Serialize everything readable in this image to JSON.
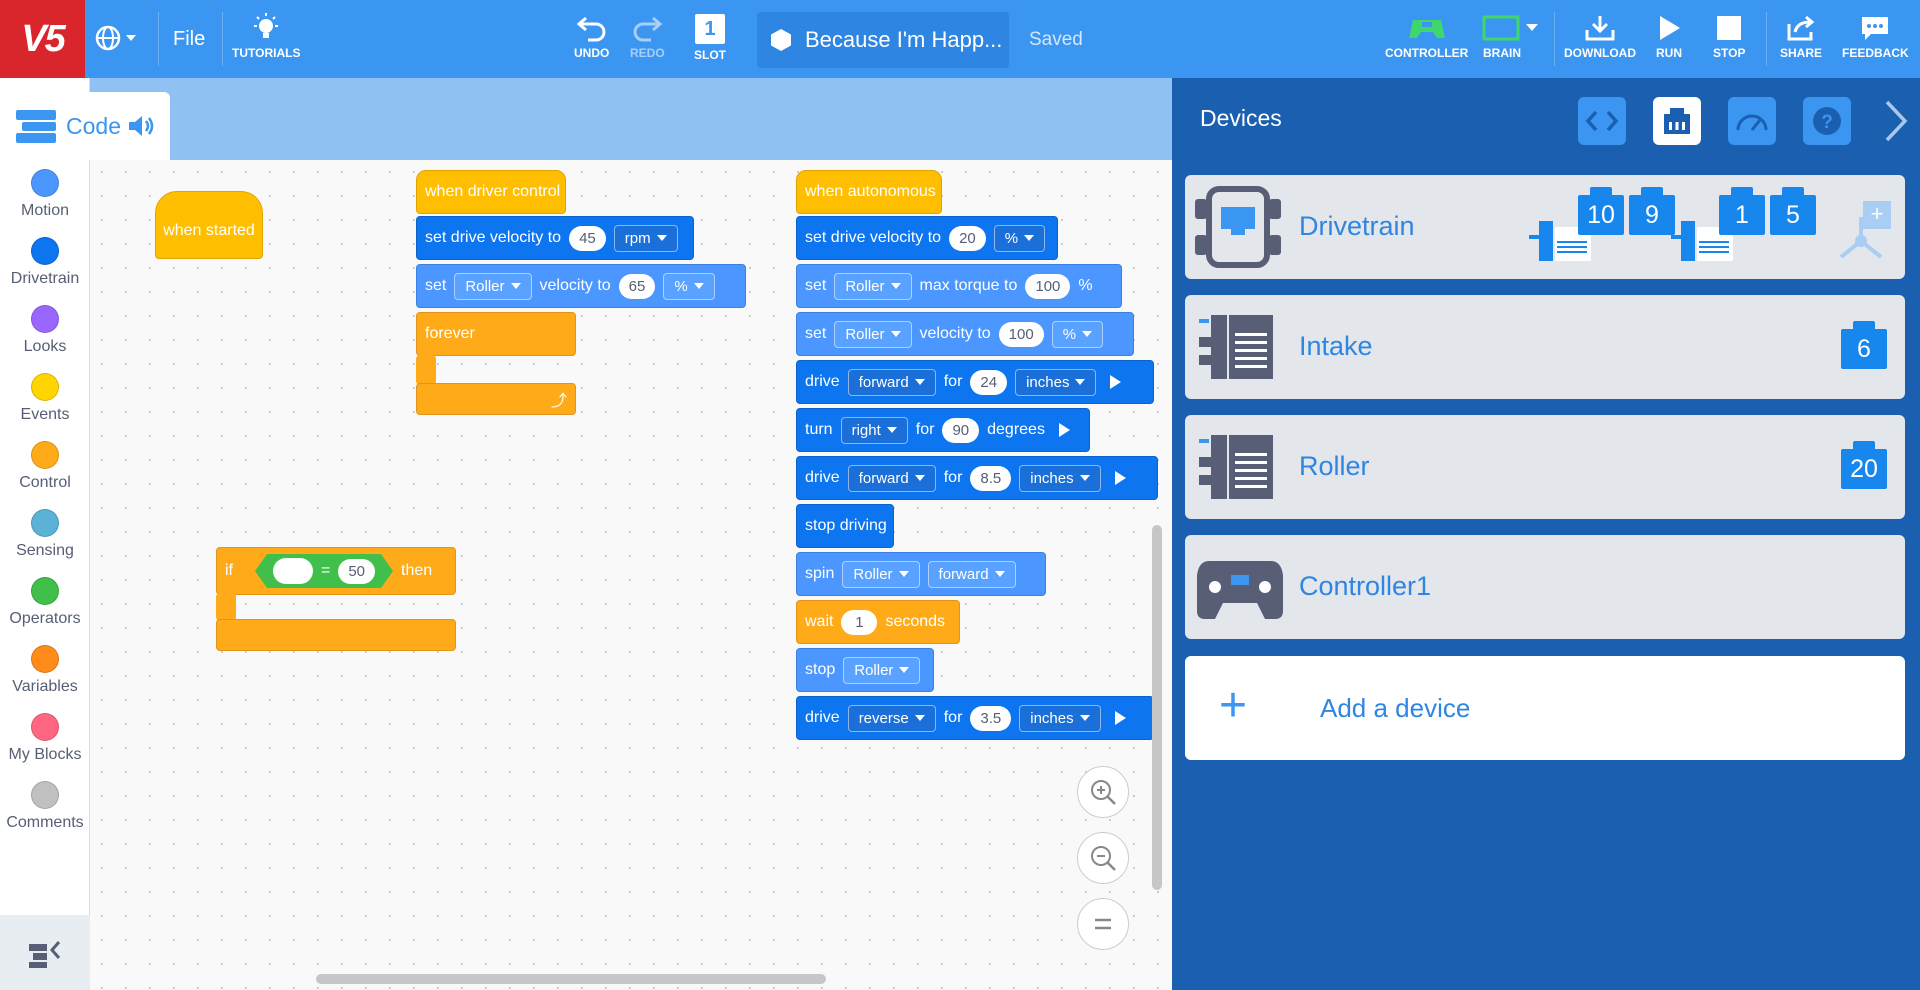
{
  "header": {
    "logo": "V5",
    "file_label": "File",
    "tutorials_label": "TUTORIALS",
    "undo_label": "UNDO",
    "redo_label": "REDO",
    "slot_label": "SLOT",
    "slot_number": "1",
    "project_name": "Because I'm Happ...",
    "save_status": "Saved",
    "controller_label": "CONTROLLER",
    "brain_label": "BRAIN",
    "download_label": "DOWNLOAD",
    "run_label": "RUN",
    "stop_label": "STOP",
    "share_label": "SHARE",
    "feedback_label": "FEEDBACK"
  },
  "code_tab": {
    "label": "Code"
  },
  "categories": [
    {
      "name": "Motion",
      "color": "#4c97ff"
    },
    {
      "name": "Drivetrain",
      "color": "#0d75f0"
    },
    {
      "name": "Looks",
      "color": "#9966ff"
    },
    {
      "name": "Events",
      "color": "#ffd500"
    },
    {
      "name": "Control",
      "color": "#ffab19"
    },
    {
      "name": "Sensing",
      "color": "#5cb1d6"
    },
    {
      "name": "Operators",
      "color": "#40bf4a"
    },
    {
      "name": "Variables",
      "color": "#ff8c1a"
    },
    {
      "name": "My Blocks",
      "color": "#ff6680"
    },
    {
      "name": "Comments",
      "color": "#c0c0c0"
    }
  ],
  "blocks": {
    "when_started": "when started",
    "when_driver": "when driver control",
    "when_auto": "when autonomous",
    "set_drive_velocity": "set drive velocity to",
    "drv_vel": "45",
    "drv_vel_unit": "rpm",
    "set": "set",
    "roller": "Roller",
    "velocity_to": "velocity to",
    "roller_vel": "65",
    "pct": "%",
    "forever": "forever",
    "auto_vel": "20",
    "max_torque_to": "max torque to",
    "torque_val": "100",
    "roller_vel2": "100",
    "drive": "drive",
    "forward": "forward",
    "for": "for",
    "dist1": "24",
    "inches": "inches",
    "turn": "turn",
    "right": "right",
    "deg_val": "90",
    "degrees": "degrees",
    "dist2": "8.5",
    "stop_driving": "stop driving",
    "spin": "spin",
    "wait": "wait",
    "wait_val": "1",
    "seconds": "seconds",
    "stop": "stop",
    "reverse": "reverse",
    "dist3": "3.5",
    "if": "if",
    "equals": "=",
    "cmp_val": "50",
    "then": "then"
  },
  "devices_panel": {
    "title": "Devices",
    "devices": [
      {
        "name": "Drivetrain",
        "ports": [
          "10",
          "9",
          "1",
          "5"
        ]
      },
      {
        "name": "Intake",
        "ports": [
          "6"
        ]
      },
      {
        "name": "Roller",
        "ports": [
          "20"
        ]
      },
      {
        "name": "Controller1",
        "ports": []
      }
    ],
    "add_label": "Add a device"
  }
}
